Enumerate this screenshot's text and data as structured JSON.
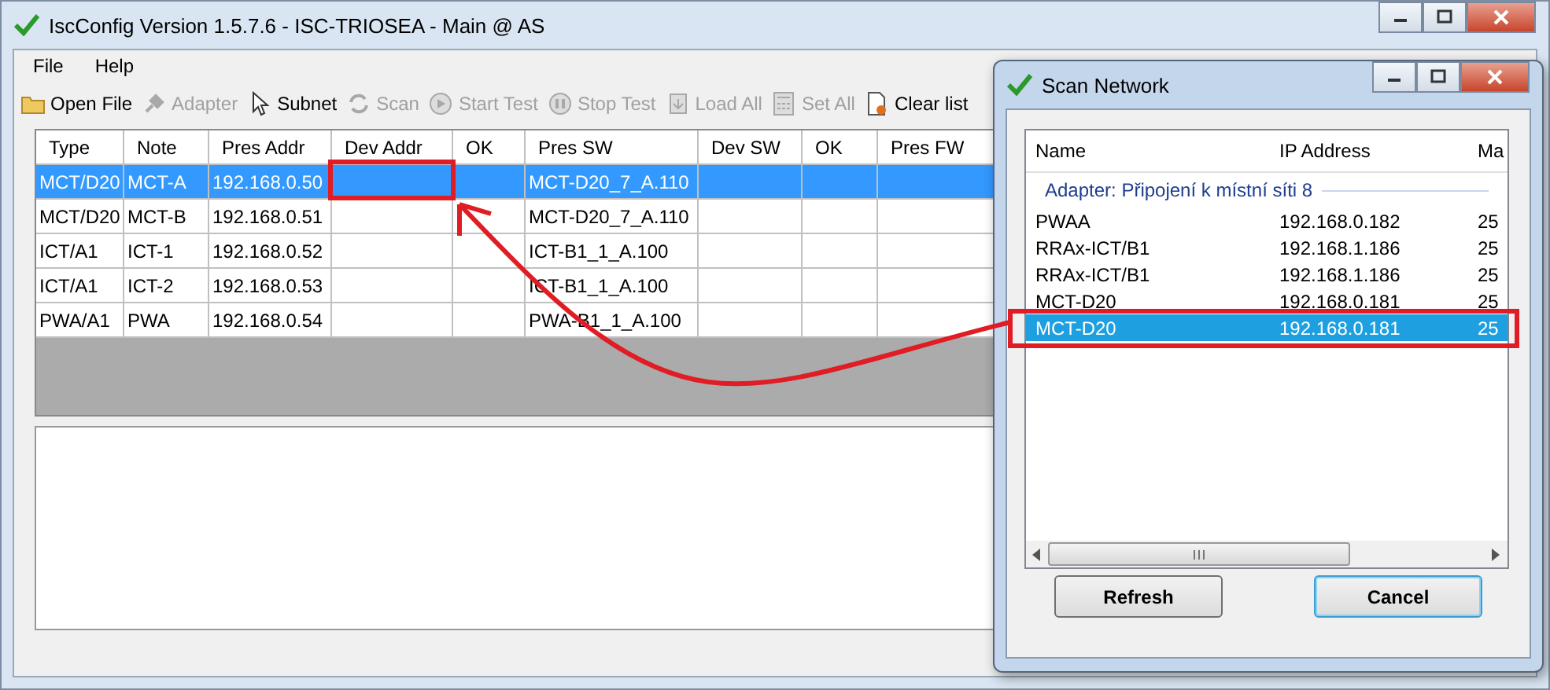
{
  "window": {
    "title": "IscConfig Version 1.5.7.6 - ISC-TRIOSEA - Main @ AS"
  },
  "menu": [
    "File",
    "Help"
  ],
  "toolbar": [
    {
      "label": "Open File",
      "disabled": false
    },
    {
      "label": "Adapter",
      "disabled": true
    },
    {
      "label": "Subnet",
      "disabled": false
    },
    {
      "label": "Scan",
      "disabled": true
    },
    {
      "label": "Start Test",
      "disabled": true
    },
    {
      "label": "Stop Test",
      "disabled": true
    },
    {
      "label": "Load All",
      "disabled": true
    },
    {
      "label": "Set All",
      "disabled": true
    },
    {
      "label": "Clear list",
      "disabled": false
    }
  ],
  "table": {
    "columns": [
      "Type",
      "Note",
      "Pres Addr",
      "Dev Addr",
      "OK",
      "Pres SW",
      "Dev SW",
      "OK",
      "Pres FW"
    ],
    "rows": [
      {
        "type": "MCT/D20",
        "note": "MCT-A",
        "pres_addr": "192.168.0.50",
        "pres_sw": "MCT-D20_7_A.110",
        "selected": true
      },
      {
        "type": "MCT/D20",
        "note": "MCT-B",
        "pres_addr": "192.168.0.51",
        "pres_sw": "MCT-D20_7_A.110",
        "selected": false
      },
      {
        "type": "ICT/A1",
        "note": "ICT-1",
        "pres_addr": "192.168.0.52",
        "pres_sw": "ICT-B1_1_A.100",
        "selected": false
      },
      {
        "type": "ICT/A1",
        "note": "ICT-2",
        "pres_addr": "192.168.0.53",
        "pres_sw": "ICT-B1_1_A.100",
        "selected": false
      },
      {
        "type": "PWA/A1",
        "note": "PWA",
        "pres_addr": "192.168.0.54",
        "pres_sw": "PWA-B1_1_A.100",
        "selected": false
      }
    ]
  },
  "dialog": {
    "title": "Scan Network",
    "columns": [
      "Name",
      "IP Address",
      "Ma"
    ],
    "group": "Adapter: Připojení k místní síti 8",
    "items": [
      {
        "name": "PWAA",
        "ip": "192.168.0.182",
        "mask": "25",
        "selected": false
      },
      {
        "name": "RRAx-ICT/B1",
        "ip": "192.168.1.186",
        "mask": "25",
        "selected": false
      },
      {
        "name": "RRAx-ICT/B1",
        "ip": "192.168.1.186",
        "mask": "25",
        "selected": false
      },
      {
        "name": "MCT-D20",
        "ip": "192.168.0.181",
        "mask": "25",
        "selected": false
      },
      {
        "name": "MCT-D20",
        "ip": "192.168.0.181",
        "mask": "25",
        "selected": true
      }
    ],
    "buttons": [
      {
        "label": "Refresh",
        "default": false
      },
      {
        "label": "Cancel",
        "default": true
      }
    ]
  }
}
